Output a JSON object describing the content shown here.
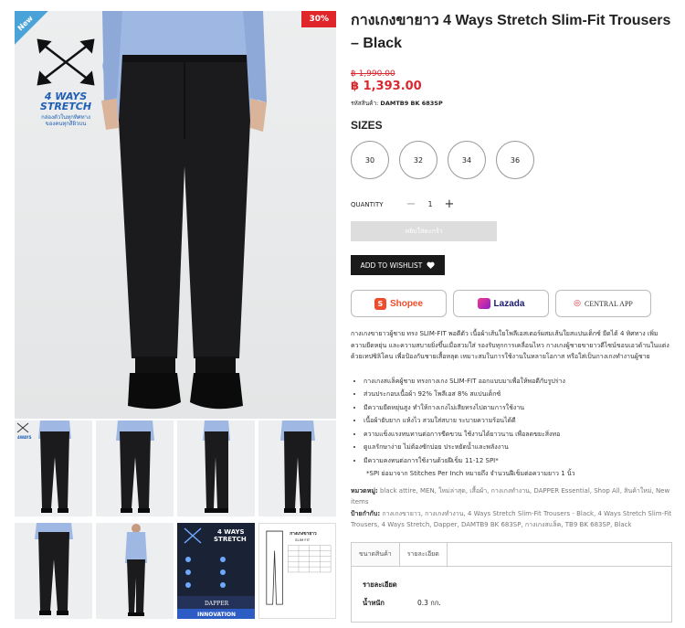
{
  "gallery": {
    "new_badge": "New",
    "sale_badge": "30%",
    "stretch_title_line1": "4 WAYS",
    "stretch_title_line2": "STRETCH",
    "stretch_sub_line1": "กล่องตัวในทุกทิศทาง",
    "stretch_sub_line2": "ของคนทุกสีผิวบน",
    "thumb_brand": "DAPPER",
    "thumb_innovation": "INNOVATION",
    "thumb_chart_title": "กางเกงขายาว",
    "thumb_chart_sub": "SLIM FIT",
    "thumb_stretch_line1": "4 WAYS",
    "thumb_stretch_line2": "STRETCH"
  },
  "product": {
    "title": "กางเกงขายาว 4 Ways Stretch Slim-Fit Trousers – Black",
    "old_price": "฿ 1,990.00",
    "new_price": "฿ 1,393.00",
    "sku_label": "รหัสสินค้า:",
    "sku_value": "DAMTB9 BK 683SP"
  },
  "sizes": {
    "heading": "SIZES",
    "options": [
      "30",
      "32",
      "34",
      "36"
    ]
  },
  "quantity": {
    "label": "QUANTITY",
    "minus": "−",
    "value": "1",
    "plus": "+"
  },
  "actions": {
    "add_to_cart": "หยิบใส่ตะกร้า",
    "wishlist": "ADD TO WISHLIST"
  },
  "shops": {
    "shopee": "Shopee",
    "lazada": "Lazada",
    "central": "CENTRAL APP"
  },
  "description": "กางเกงขายาวผู้ชาย ทรง SLIM-FIT พอดีตัว เนื้อผ้าเส้นใยโพลีเอสเตอร์ผสมเส้นใยสแปนเด็กซ์ ยืดได้ 4 ทิศทาง เพิ่มความยืดหยุ่น และความสบายยิ่งขึ้นเมื่อสวมใส่ รองรับทุกการเคลื่อนไหว กางเกงผู้ชายขายาวดีไซน์ขอบเอวด้านในแต่งด้วยเทปซิลิโคน เพื่อป้องกันชายเสื้อหลุด เหมาะสมในการใช้งานในหลายโอกาส หรือใส่เป็นกางเกงทำงานผู้ชาย",
  "bullets": [
    "กางเกงสแล็คผู้ชาย ทรงกางเกง SLIM-FIT ออกแบบมาเพื่อให้พอดีกับรูปร่าง",
    "ส่วนประกอบเนื้อผ้า 92% โพลีเอส 8% สแปนเด็กซ์",
    "มีความยืดหยุ่นสูง ทำให้กางเกงไม่เสียทรงไปตามการใช้งาน",
    "เนื้อผ้ายับยาก แห้งไว สวมใส่สบาย ระบายความร้อนได้ดี",
    "ความแข็งแรงทนทานต่อการขีดขวน ใช้งานได้ยาวนาน เพื่อลดขยะสิ่งทอ",
    "ดูแลรักษาง่าย ไม่ต้องซักบ่อย ประหยัดน้ำและพลังงาน",
    "มีความคงทนต่อการใช้งานด้วยฝีเข็ม 11-12 SPI*"
  ],
  "bullet_note": "*SPI ย่อมาจาก Stitches Per Inch หมายถึง จำนวนฝีเข็มต่อความยาว 1 นิ้ว",
  "meta": {
    "category_label": "หมวดหมู่:",
    "category_value": "black attire, MEN, ใหม่ล่าสุด, เสื้อผ้า, กางเกงทำงาน, DAPPER Essential, Shop All, สินค้าใหม่, New items",
    "tags_label": "ป้ายกำกับ:",
    "tags_value": "กางเกงขายาว, กางเกงทำงาน, 4 Ways Stretch Slim-Fit Trousers - Black, 4 Ways Stretch Slim-Fit Trousers, 4 Ways Stretch, Dapper, DAMTB9 BK 683SP, กางเกงสแล็ค, TB9 BK 683SP, Black"
  },
  "tabs": {
    "items": [
      "ขนาดสินค้า",
      "รายละเอียด"
    ],
    "detail_heading": "รายละเอียด",
    "weight_label": "น้ำหนัก",
    "weight_value": "0.3 กก."
  },
  "colors": {
    "price_red": "#d9282f",
    "stretch_blue": "#1f5fb5",
    "shopee_orange": "#ee4d2d"
  }
}
